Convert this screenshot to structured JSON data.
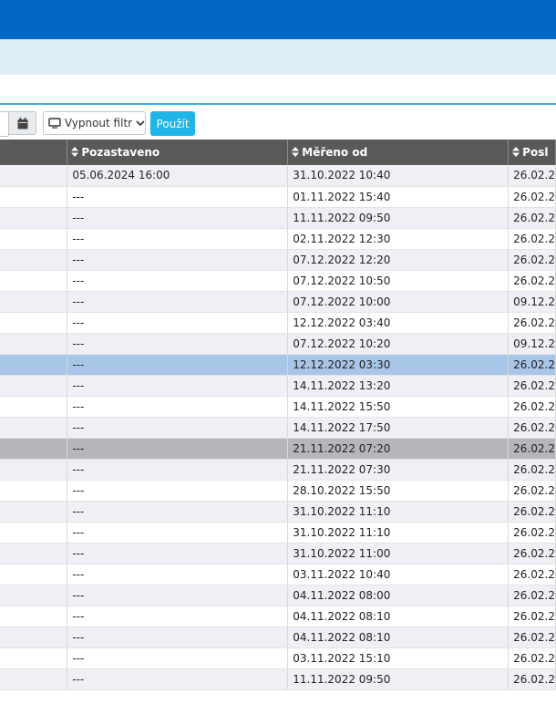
{
  "toolbar": {
    "filter_label": "Vypnout filtr",
    "apply_label": "Použít"
  },
  "table": {
    "columns": [
      "Pozastaveno",
      "Měřeno od",
      "Posl"
    ],
    "rows": [
      {
        "pozastaveno": "05.06.2024 16:00",
        "mereno_od": "31.10.2022 10:40",
        "posl": "26.02.2"
      },
      {
        "pozastaveno": "---",
        "mereno_od": "01.11.2022 15:40",
        "posl": "26.02.2"
      },
      {
        "pozastaveno": "---",
        "mereno_od": "11.11.2022 09:50",
        "posl": "26.02.2"
      },
      {
        "pozastaveno": "---",
        "mereno_od": "02.11.2022 12:30",
        "posl": "26.02.2"
      },
      {
        "pozastaveno": "---",
        "mereno_od": "07.12.2022 12:20",
        "posl": "26.02.2"
      },
      {
        "pozastaveno": "---",
        "mereno_od": "07.12.2022 10:50",
        "posl": "26.02.2"
      },
      {
        "pozastaveno": "---",
        "mereno_od": "07.12.2022 10:00",
        "posl": "09.12.2"
      },
      {
        "pozastaveno": "---",
        "mereno_od": "12.12.2022 03:40",
        "posl": "26.02.2"
      },
      {
        "pozastaveno": "---",
        "mereno_od": "07.12.2022 10:20",
        "posl": "09.12.2"
      },
      {
        "pozastaveno": "---",
        "mereno_od": "12.12.2022 03:30",
        "posl": "26.02.2"
      },
      {
        "pozastaveno": "---",
        "mereno_od": "14.11.2022 13:20",
        "posl": "26.02.2"
      },
      {
        "pozastaveno": "---",
        "mereno_od": "14.11.2022 15:50",
        "posl": "26.02.2"
      },
      {
        "pozastaveno": "---",
        "mereno_od": "14.11.2022 17:50",
        "posl": "26.02.2"
      },
      {
        "pozastaveno": "---",
        "mereno_od": "21.11.2022 07:20",
        "posl": "26.02.2"
      },
      {
        "pozastaveno": "---",
        "mereno_od": "21.11.2022 07:30",
        "posl": "26.02.2"
      },
      {
        "pozastaveno": "---",
        "mereno_od": "28.10.2022 15:50",
        "posl": "26.02.2"
      },
      {
        "pozastaveno": "---",
        "mereno_od": "31.10.2022 11:10",
        "posl": "26.02.2"
      },
      {
        "pozastaveno": "---",
        "mereno_od": "31.10.2022 11:10",
        "posl": "26.02.2"
      },
      {
        "pozastaveno": "---",
        "mereno_od": "31.10.2022 11:00",
        "posl": "26.02.2"
      },
      {
        "pozastaveno": "---",
        "mereno_od": "03.11.2022 10:40",
        "posl": "26.02.2"
      },
      {
        "pozastaveno": "---",
        "mereno_od": "04.11.2022 08:00",
        "posl": "26.02.2"
      },
      {
        "pozastaveno": "---",
        "mereno_od": "04.11.2022 08:10",
        "posl": "26.02.2"
      },
      {
        "pozastaveno": "---",
        "mereno_od": "04.11.2022 08:10",
        "posl": "26.02.2"
      },
      {
        "pozastaveno": "---",
        "mereno_od": "03.11.2022 15:10",
        "posl": "26.02.2"
      },
      {
        "pozastaveno": "---",
        "mereno_od": "11.11.2022 09:50",
        "posl": "26.02.2"
      }
    ]
  },
  "row_states": {
    "selected_row": 9,
    "highlighted_row": 13
  },
  "colors": {
    "header_bar": "#0069c7",
    "sub_bar": "#dcedf6",
    "accent_line": "#3fa8de",
    "table_header": "#595959",
    "row_stripe": "#eef0f5",
    "selected_row": "#a8c6e8",
    "highlighted_row": "#b4b6b9",
    "apply_button": "#1fb5e6"
  },
  "icons": {
    "calendar": "calendar-icon",
    "monitor": "monitor-icon",
    "chevron": "chevron-down-icon",
    "sort": "sort-icon"
  }
}
